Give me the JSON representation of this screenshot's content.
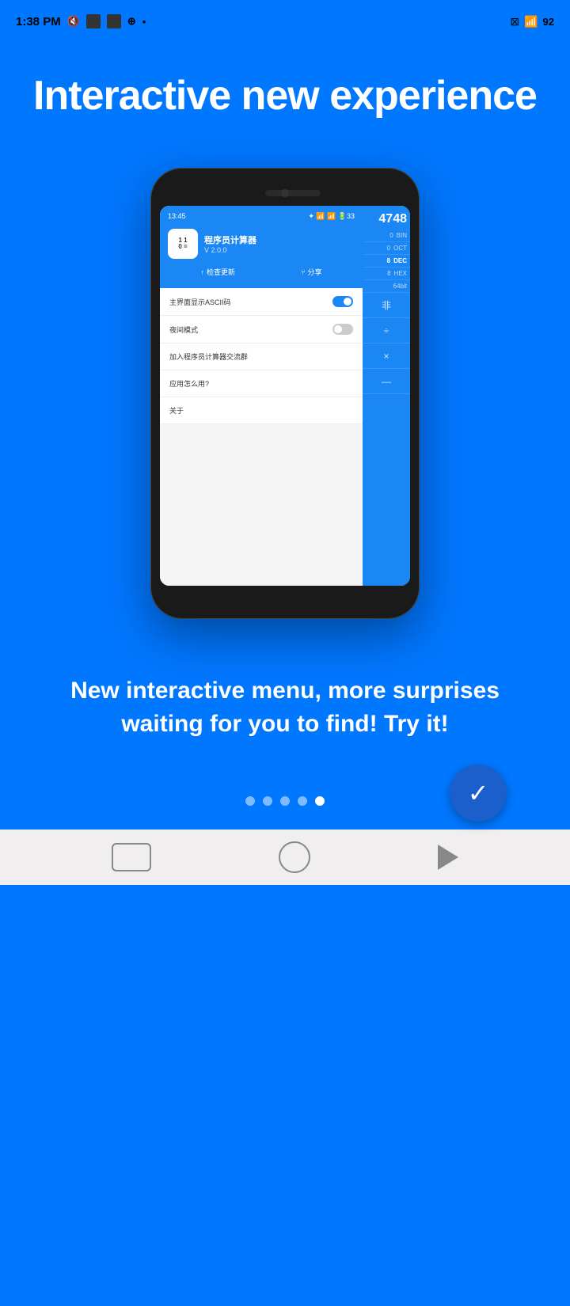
{
  "statusBar": {
    "time": "1:38 PM",
    "battery": "92",
    "wifi": true
  },
  "hero": {
    "headline": "Interactive new experience"
  },
  "phoneScreen": {
    "innerTime": "13:45",
    "appName": "程序员计算器",
    "appVersion": "V 2.0.0",
    "appIconLines": [
      "1  1",
      "0  ="
    ],
    "checkUpdateLabel": "检查更新",
    "shareLabel": "分享",
    "calcDisplay": "4748",
    "settings": [
      {
        "label": "主界面显示ASCII码",
        "type": "toggle-on"
      },
      {
        "label": "夜间模式",
        "type": "toggle-off"
      },
      {
        "label": "加入程序员计算器交流群",
        "type": "link"
      },
      {
        "label": "应用怎么用?",
        "type": "link"
      },
      {
        "label": "关于",
        "type": "link"
      }
    ],
    "calcModes": [
      "BIN",
      "OCT",
      "DEC",
      "HEX"
    ],
    "activeModes": [
      "DEC"
    ],
    "calcBitLabel": "64bit",
    "calcOps": [
      "非",
      "÷",
      "×",
      "—"
    ]
  },
  "bottomText": "New interactive menu, more surprises waiting for you to find! Try it!",
  "pagination": {
    "dots": [
      false,
      false,
      false,
      false,
      true
    ],
    "activeIndex": 4
  },
  "fab": {
    "icon": "✓"
  },
  "bottomNav": {
    "back": "◁",
    "home": "○",
    "recent": "□"
  }
}
